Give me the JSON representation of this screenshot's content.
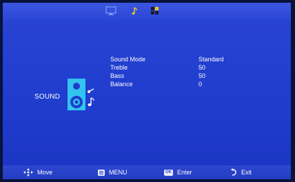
{
  "tabs": [
    {
      "name": "picture",
      "icon": "monitor-icon"
    },
    {
      "name": "sound",
      "icon": "music-note-icon",
      "active": true
    },
    {
      "name": "setup",
      "icon": "grid-icon"
    }
  ],
  "section": {
    "title": "SOUND",
    "icon": "speaker-icon"
  },
  "menu": {
    "items": [
      {
        "label": "Sound Mode",
        "value": "Standard"
      },
      {
        "label": "Treble",
        "value": "50"
      },
      {
        "label": "Bass",
        "value": "50"
      },
      {
        "label": "Balance",
        "value": "0"
      }
    ]
  },
  "footer": {
    "move": {
      "label": "Move",
      "icon": "dpad-icon"
    },
    "menu": {
      "label": "MENU",
      "icon": "menu-key-icon"
    },
    "enter": {
      "label": "Enter",
      "icon": "ok-key-icon",
      "key_text": "OK"
    },
    "exit": {
      "label": "Exit",
      "icon": "return-arrow-icon"
    }
  },
  "colors": {
    "background": "#1f3ccd",
    "accent": "#33c4ef",
    "text": "#ffffff"
  }
}
